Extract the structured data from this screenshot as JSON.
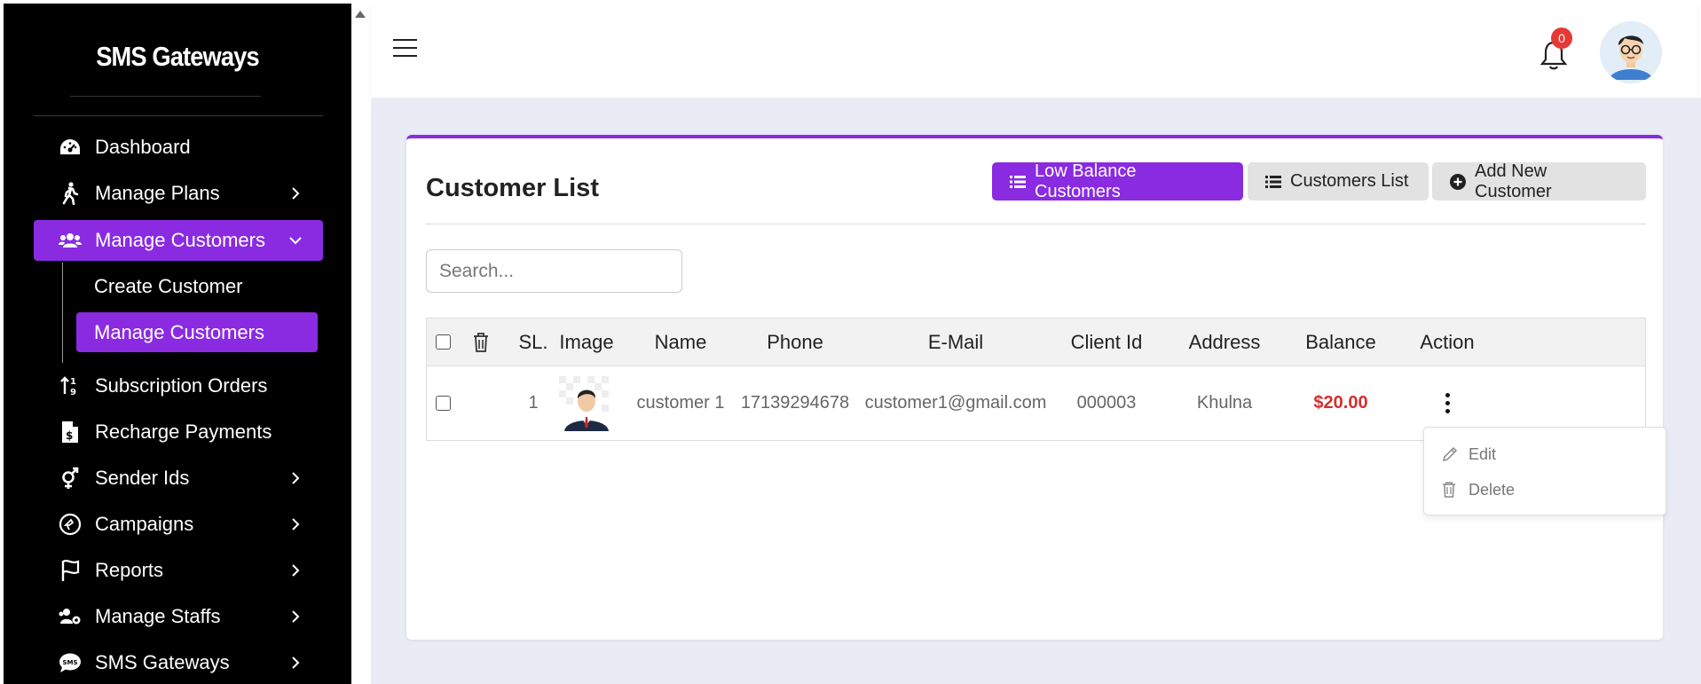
{
  "sidebar": {
    "brand": "SMS Gateways",
    "items": [
      {
        "label": "Dashboard",
        "icon": "gauge-icon",
        "has_chevron": false
      },
      {
        "label": "Manage Plans",
        "icon": "walking-person-icon",
        "has_chevron": true
      },
      {
        "label": "Manage Customers",
        "icon": "users-icon",
        "has_chevron": true,
        "expanded": true
      },
      {
        "label": "Subscription Orders",
        "icon": "sort-arrows-icon",
        "has_chevron": false
      },
      {
        "label": "Recharge Payments",
        "icon": "invoice-dollar-icon",
        "has_chevron": false
      },
      {
        "label": "Sender Ids",
        "icon": "gender-icon",
        "has_chevron": true
      },
      {
        "label": "Campaigns",
        "icon": "campaign-icon",
        "has_chevron": true
      },
      {
        "label": "Reports",
        "icon": "flag-icon",
        "has_chevron": true
      },
      {
        "label": "Manage Staffs",
        "icon": "users-gear-icon",
        "has_chevron": true
      },
      {
        "label": "SMS Gateways",
        "icon": "sms-bubble-icon",
        "has_chevron": true
      }
    ],
    "submenu": [
      {
        "label": "Create Customer"
      },
      {
        "label": "Manage Customers",
        "active": true
      }
    ]
  },
  "header": {
    "notification_count": "0"
  },
  "main": {
    "title": "Customer List",
    "buttons": {
      "low_balance": "Low Balance Customers",
      "customers_list": "Customers List",
      "add_new": "Add New Customer"
    },
    "search": {
      "placeholder": "Search...",
      "value": ""
    },
    "table": {
      "headers": {
        "sl": "SL.",
        "image": "Image",
        "name": "Name",
        "phone": "Phone",
        "email": "E-Mail",
        "client_id": "Client Id",
        "address": "Address",
        "balance": "Balance",
        "action": "Action"
      },
      "rows": [
        {
          "sl": "1",
          "name": "customer 1",
          "phone": "17139294678",
          "email": "customer1@gmail.com",
          "client_id": "000003",
          "address": "Khulna",
          "balance": "$20.00"
        }
      ]
    },
    "action_menu": {
      "edit": "Edit",
      "delete": "Delete"
    }
  },
  "colors": {
    "accent": "#8a2be2",
    "sidebar_bg": "#000000",
    "balance": "#d32f2f",
    "badge": "#e53935"
  }
}
